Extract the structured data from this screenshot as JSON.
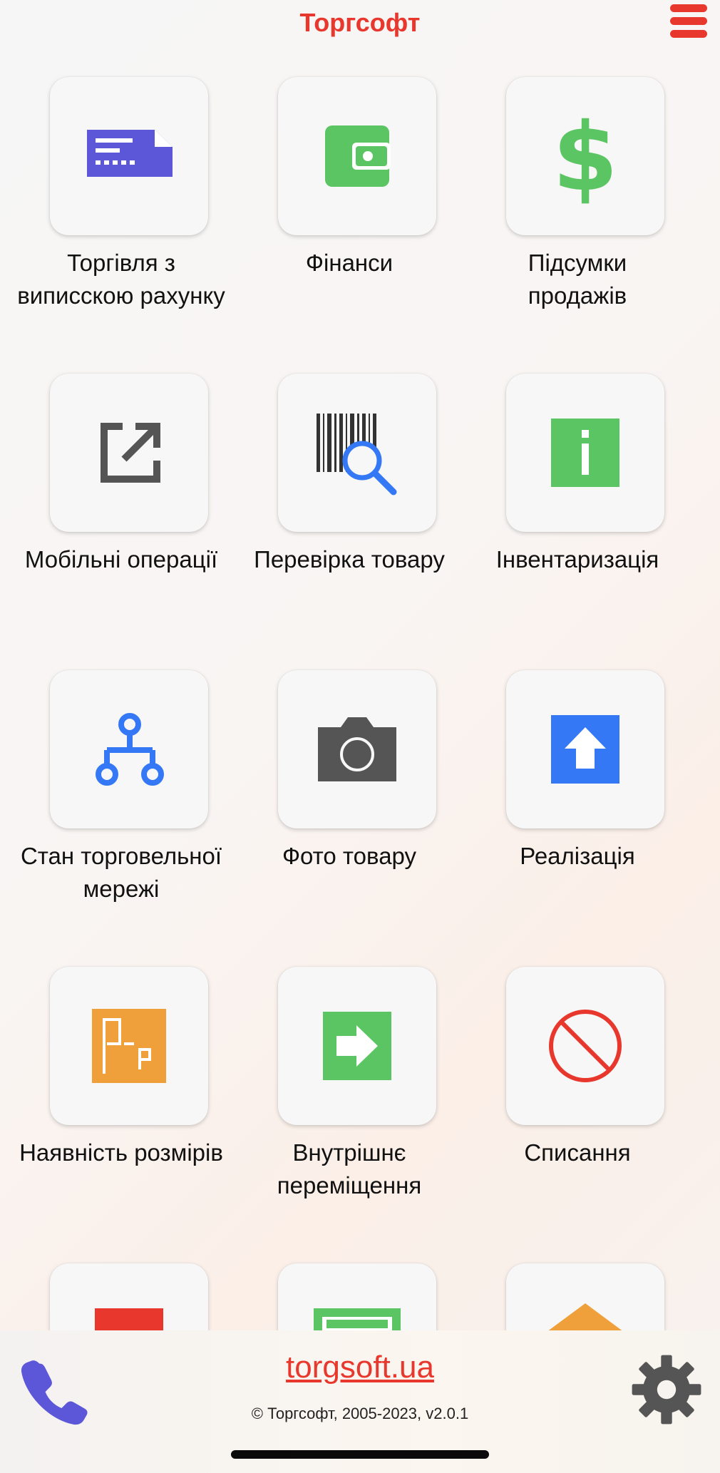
{
  "header": {
    "title": "Торгсофт"
  },
  "tiles": [
    {
      "label": "Торгівля з\nвиписскою рахунку",
      "icon": "invoice-icon"
    },
    {
      "label": "Фінанси",
      "icon": "wallet-icon"
    },
    {
      "label": "Підсумки\nпродажів",
      "icon": "dollar-icon"
    },
    {
      "label": "Мобільні операції",
      "icon": "open-in-new-icon"
    },
    {
      "label": "Перевірка товару",
      "icon": "barcode-search-icon"
    },
    {
      "label": "Інвентаризація",
      "icon": "info-icon"
    },
    {
      "label": "Стан торговельної\nмережі",
      "icon": "network-icon"
    },
    {
      "label": "Фото товару",
      "icon": "camera-icon"
    },
    {
      "label": "Реалізація",
      "icon": "arrow-up-icon"
    },
    {
      "label": "Наявність розмірів",
      "icon": "size-availability-icon"
    },
    {
      "label": "Внутрішнє\nпереміщення",
      "icon": "arrow-right-icon"
    },
    {
      "label": "Списання",
      "icon": "prohibited-icon"
    },
    {
      "label": "",
      "icon": "red-document-icon"
    },
    {
      "label": "",
      "icon": "green-card-icon"
    },
    {
      "label": "",
      "icon": "orange-up-icon"
    }
  ],
  "footer": {
    "link": "torgsoft.ua",
    "copyright": "© Торгсофт, 2005-2023, v2.0.1",
    "phone_icon": "phone-icon",
    "settings_icon": "gear-icon"
  },
  "colors": {
    "brand_red": "#e8372c",
    "green": "#5cc563",
    "blue": "#3478f6",
    "indigo": "#5b57d8",
    "orange": "#f0a03a",
    "gray": "#555555"
  }
}
